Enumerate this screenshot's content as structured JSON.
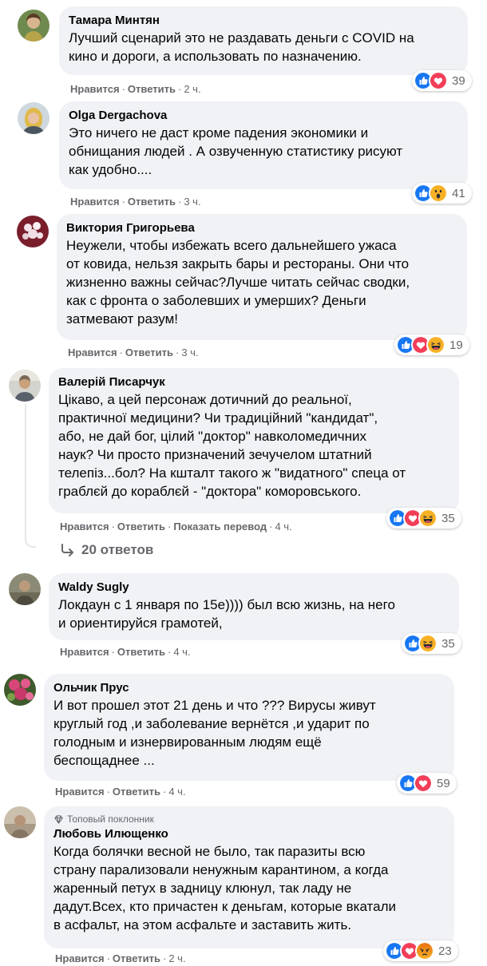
{
  "actions": {
    "like": "Нравится",
    "reply": "Ответить",
    "translate": "Показать перевод",
    "dot": "·"
  },
  "colors": {
    "like_blue": "#1877f2",
    "love_red": "#f33e58",
    "haha_yellow": "#f7b125",
    "angry_orange": "#e9710f",
    "bubble_bg": "#f0f2f5",
    "meta_gray": "#65676b"
  },
  "comments": [
    {
      "author": "Тамара Минтян",
      "text": "Лучший сценарий это не раздавать деньги с COVID на\nкино и дороги, а использовать по назначению.",
      "time": "2 ч.",
      "reactions": [
        "like-icon",
        "love-icon"
      ],
      "count": "39"
    },
    {
      "author": "Olga Dergachova",
      "text": "Это ничего не даст кроме падения экономики и\nобнищания людей . А озвученную статистику рисуют\nкак удобно....",
      "time": "3 ч.",
      "reactions": [
        "like-icon",
        "wow-icon"
      ],
      "count": "41"
    },
    {
      "author": "Виктория Григорьева",
      "text": "Неужели, чтобы избежать всего дальнейшего ужаса\nот ковида, нельзя закрыть бары и рестораны. Они что\nжизненно важны сейчас?Лучше читать сейчас сводки,\nкак с фронта о заболевших и умерших? Деньги\nзатмевают разум!",
      "time": "3 ч.",
      "reactions": [
        "like-icon",
        "love-icon",
        "haha-icon"
      ],
      "count": "19"
    },
    {
      "author": "Валерій Писарчук",
      "text": "Цікаво, а цей персонаж дотичний до реальної,\nпрактичної медицини? Чи традиційний \"кандидат\",\nабо, не дай бог, цілий \"доктор\" навколомедичних\nнаук? Чи просто призначений зечучелом штатний\nтелепіз...бол? На кшталт такого ж \"видатного\" спеца от\nграблєй до кораблєй - \"доктора\" коморовського.",
      "time": "4 ч.",
      "reactions": [
        "like-icon",
        "love-icon",
        "haha-icon"
      ],
      "count": "35",
      "replies": "20 ответов"
    },
    {
      "author": "Waldy Sugly",
      "text": "Локдаун с 1 января по 15е)))) был всю жизнь, на него\nи ориентируйся грамотей,",
      "time": "4 ч.",
      "reactions": [
        "like-icon",
        "haha-icon"
      ],
      "count": "35"
    },
    {
      "author": "Ольчик Прус",
      "text": "И вот прошел этот 21 день и что ??? Вирусы живут\nкруглый год ,и заболевание вернётся ,и ударит по\nголодным и изнервированным людям ещё\nбеспощаднее ...",
      "time": "4 ч.",
      "reactions": [
        "like-icon",
        "love-icon"
      ],
      "count": "59"
    },
    {
      "author": "Любовь Илющенко",
      "badge": "Топовый поклонник",
      "text": "Когда болячки весной не было, так паразиты всю\nстрану парализовали ненужным карантином, а когда\nжаренный петух в задницу клюнул, так ладу не\nдадут.Всех, кто причастен к деньгам, которые вкатали\nв асфальт, на этом асфальте и заставить жить.",
      "time": "2 ч.",
      "reactions": [
        "like-icon",
        "love-icon",
        "angry-icon"
      ],
      "count": "23"
    }
  ]
}
